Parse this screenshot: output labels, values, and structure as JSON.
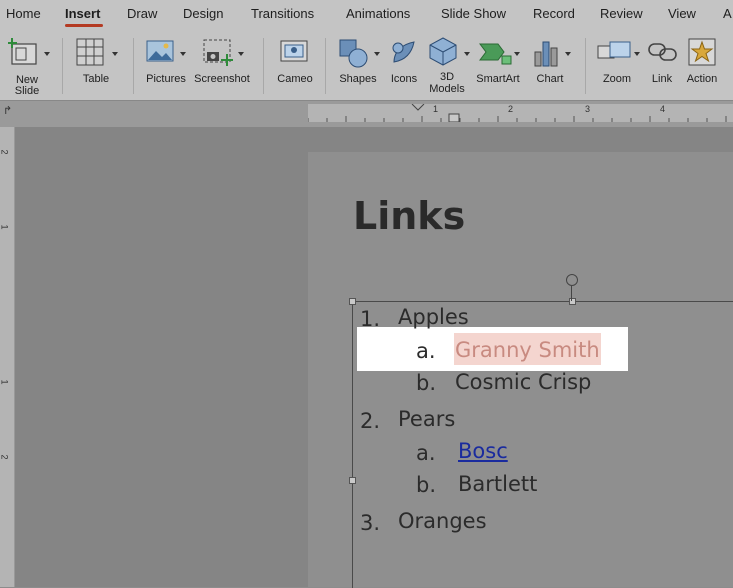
{
  "menu": {
    "tabs": [
      "Home",
      "Insert",
      "Draw",
      "Design",
      "Transitions",
      "Animations",
      "Slide Show",
      "Record",
      "Review",
      "View",
      "A"
    ],
    "active_tab": "Insert"
  },
  "ribbon": {
    "new_slide": "New\nSlide",
    "table": "Table",
    "pictures": "Pictures",
    "screenshot": "Screenshot",
    "cameo": "Cameo",
    "shapes": "Shapes",
    "icons": "Icons",
    "models3d": "3D\nModels",
    "smartart": "SmartArt",
    "chart": "Chart",
    "zoom": "Zoom",
    "link": "Link",
    "action": "Action"
  },
  "ruler": {
    "marks": [
      "1",
      "2",
      "3",
      "4"
    ]
  },
  "vruler": {
    "marks": [
      "2",
      "1",
      "1",
      "2"
    ]
  },
  "slide": {
    "title": "Links",
    "list": [
      {
        "num": "1.",
        "text": "Apples"
      },
      {
        "num": "a.",
        "text": "Granny Smith"
      },
      {
        "num": "b.",
        "text": "Cosmic Crisp"
      },
      {
        "num": "2.",
        "text": "Pears"
      },
      {
        "num": "a.",
        "text": "Bosc"
      },
      {
        "num": "b.",
        "text": "Bartlett"
      },
      {
        "num": "3.",
        "text": "Oranges"
      }
    ]
  },
  "colors": {
    "accent": "#b43a22",
    "link": "#1a2b9e",
    "selection": "#f4d5cf"
  }
}
